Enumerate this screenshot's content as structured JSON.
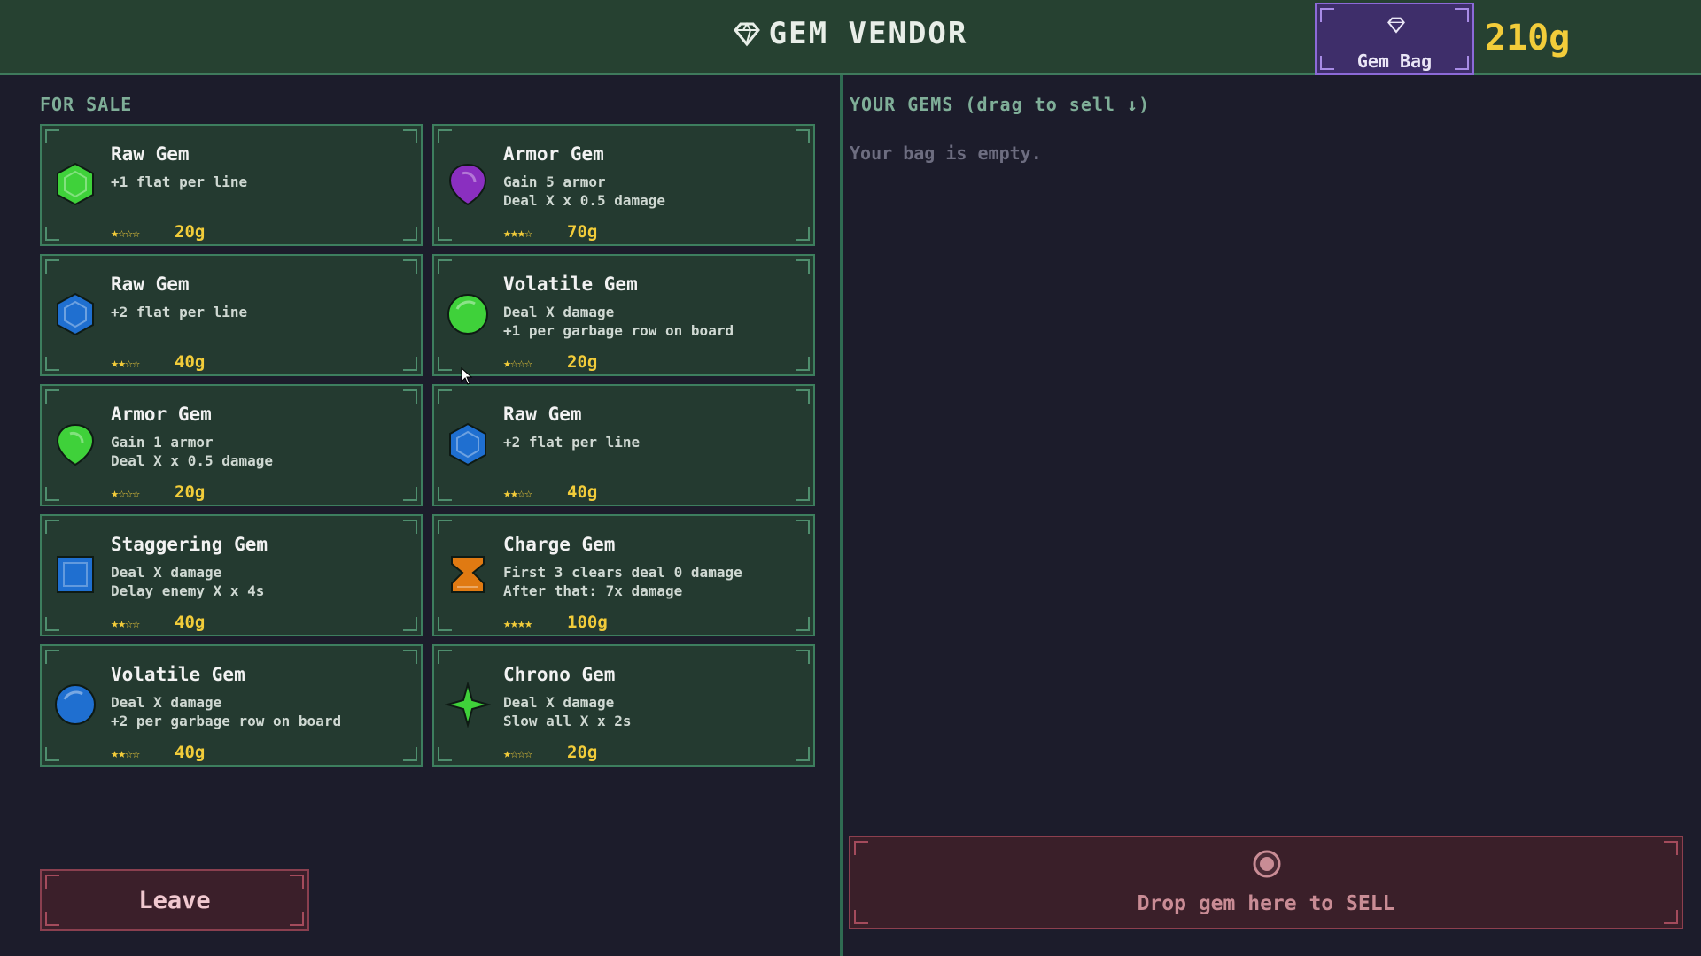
{
  "header": {
    "title": "GEM VENDOR",
    "bag_label": "Gem Bag",
    "gold": "210g"
  },
  "shop": {
    "section_label": "FOR SALE",
    "items": [
      {
        "name": "Raw Gem",
        "desc": [
          "+1 flat per line"
        ],
        "stars": "★☆☆☆",
        "rarity": 1,
        "price": "20g",
        "icon": "green-hexagon-gem-icon",
        "color": "#3fd13a"
      },
      {
        "name": "Armor Gem",
        "desc": [
          "Gain 5 armor",
          "Deal X x 0.5 damage"
        ],
        "stars": "★★★☆",
        "rarity": 3,
        "price": "70g",
        "icon": "purple-shield-gem-icon",
        "color": "#8a2fc0"
      },
      {
        "name": "Raw Gem",
        "desc": [
          "+2 flat per line"
        ],
        "stars": "★★☆☆",
        "rarity": 2,
        "price": "40g",
        "icon": "blue-hexagon-gem-icon",
        "color": "#1f6fd0"
      },
      {
        "name": "Volatile Gem",
        "desc": [
          "Deal X damage",
          "+1 per garbage row on board"
        ],
        "stars": "★☆☆☆",
        "rarity": 1,
        "price": "20g",
        "icon": "green-round-gem-icon",
        "color": "#3fd13a"
      },
      {
        "name": "Armor Gem",
        "desc": [
          "Gain 1 armor",
          "Deal X x 0.5 damage"
        ],
        "stars": "★☆☆☆",
        "rarity": 1,
        "price": "20g",
        "icon": "green-shield-gem-icon",
        "color": "#3fd13a"
      },
      {
        "name": "Raw Gem",
        "desc": [
          "+2 flat per line"
        ],
        "stars": "★★☆☆",
        "rarity": 2,
        "price": "40g",
        "icon": "blue-hexagon-gem-icon",
        "color": "#1f6fd0"
      },
      {
        "name": "Staggering Gem",
        "desc": [
          "Deal X damage",
          "Delay enemy X x 4s"
        ],
        "stars": "★★☆☆",
        "rarity": 2,
        "price": "40g",
        "icon": "blue-square-gem-icon",
        "color": "#1f6fd0"
      },
      {
        "name": "Charge Gem",
        "desc": [
          "First 3 clears deal 0 damage",
          "After that: 7x damage"
        ],
        "stars": "★★★★",
        "rarity": 4,
        "price": "100g",
        "icon": "orange-hourglass-gem-icon",
        "color": "#e07a12"
      },
      {
        "name": "Volatile Gem",
        "desc": [
          "Deal X damage",
          "+2 per garbage row on board"
        ],
        "stars": "★★☆☆",
        "rarity": 2,
        "price": "40g",
        "icon": "blue-round-gem-icon",
        "color": "#1f6fd0"
      },
      {
        "name": "Chrono Gem",
        "desc": [
          "Deal X damage",
          "Slow all X x 2s"
        ],
        "stars": "★☆☆☆",
        "rarity": 1,
        "price": "20g",
        "icon": "green-star-gem-icon",
        "color": "#3fd13a"
      }
    ]
  },
  "inventory": {
    "section_label": "YOUR GEMS  (drag to sell ↓)",
    "empty_text": "Your bag is empty."
  },
  "footer": {
    "leave_label": "Leave",
    "sell_label": "Drop gem here to SELL"
  }
}
